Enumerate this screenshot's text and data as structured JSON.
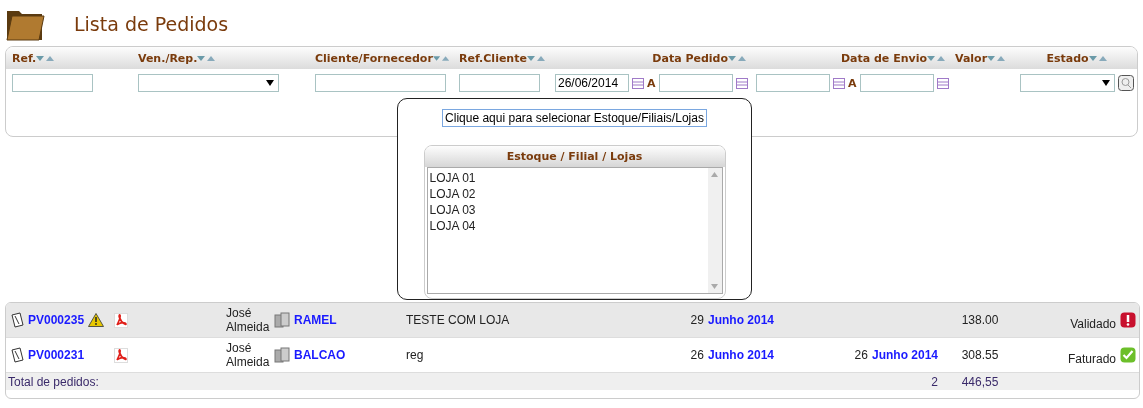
{
  "title": "Lista de Pedidos",
  "columns": [
    {
      "label": "Ref.",
      "kind": "text"
    },
    {
      "label": "Ven./Rep.",
      "kind": "select"
    },
    {
      "label": "Cliente/Fornecedor",
      "kind": "text"
    },
    {
      "label": "Ref.Cliente",
      "kind": "text"
    },
    {
      "label": "Data Pedido",
      "kind": "range",
      "from": "26/06/2014",
      "sep": "A"
    },
    {
      "label": "Data de Envio",
      "kind": "range",
      "sep": "A"
    },
    {
      "label": "Valor",
      "kind": "none"
    },
    {
      "label": "Estado",
      "kind": "select"
    }
  ],
  "store_button": "Clique aqui para selecionar Estoque/Filiais/Lojas",
  "store_list": {
    "title": "Estoque / Filial / Lojas",
    "items": [
      "LOJA 01",
      "LOJA 02",
      "LOJA 03",
      "LOJA 04"
    ]
  },
  "orders": [
    {
      "ref": "PV000235",
      "warning": true,
      "seller": "José Almeida",
      "client": "RAMEL",
      "note": "TESTE COM LOJA",
      "order_day": "29",
      "order_month": "Junho 2014",
      "value": "138.00",
      "status": "Validado",
      "kind": "alert"
    },
    {
      "ref": "PV000231",
      "warning": false,
      "seller": "José Almeida",
      "client": "BALCAO",
      "note": "reg",
      "order_day": "26",
      "order_month": "Junho 2014",
      "ship_day": "26",
      "ship_month": "Junho 2014",
      "value": "308.55",
      "status": "Faturado",
      "kind": "ok"
    }
  ],
  "total": {
    "label": "Total de pedidos:",
    "count": "2",
    "value": "446,55"
  }
}
